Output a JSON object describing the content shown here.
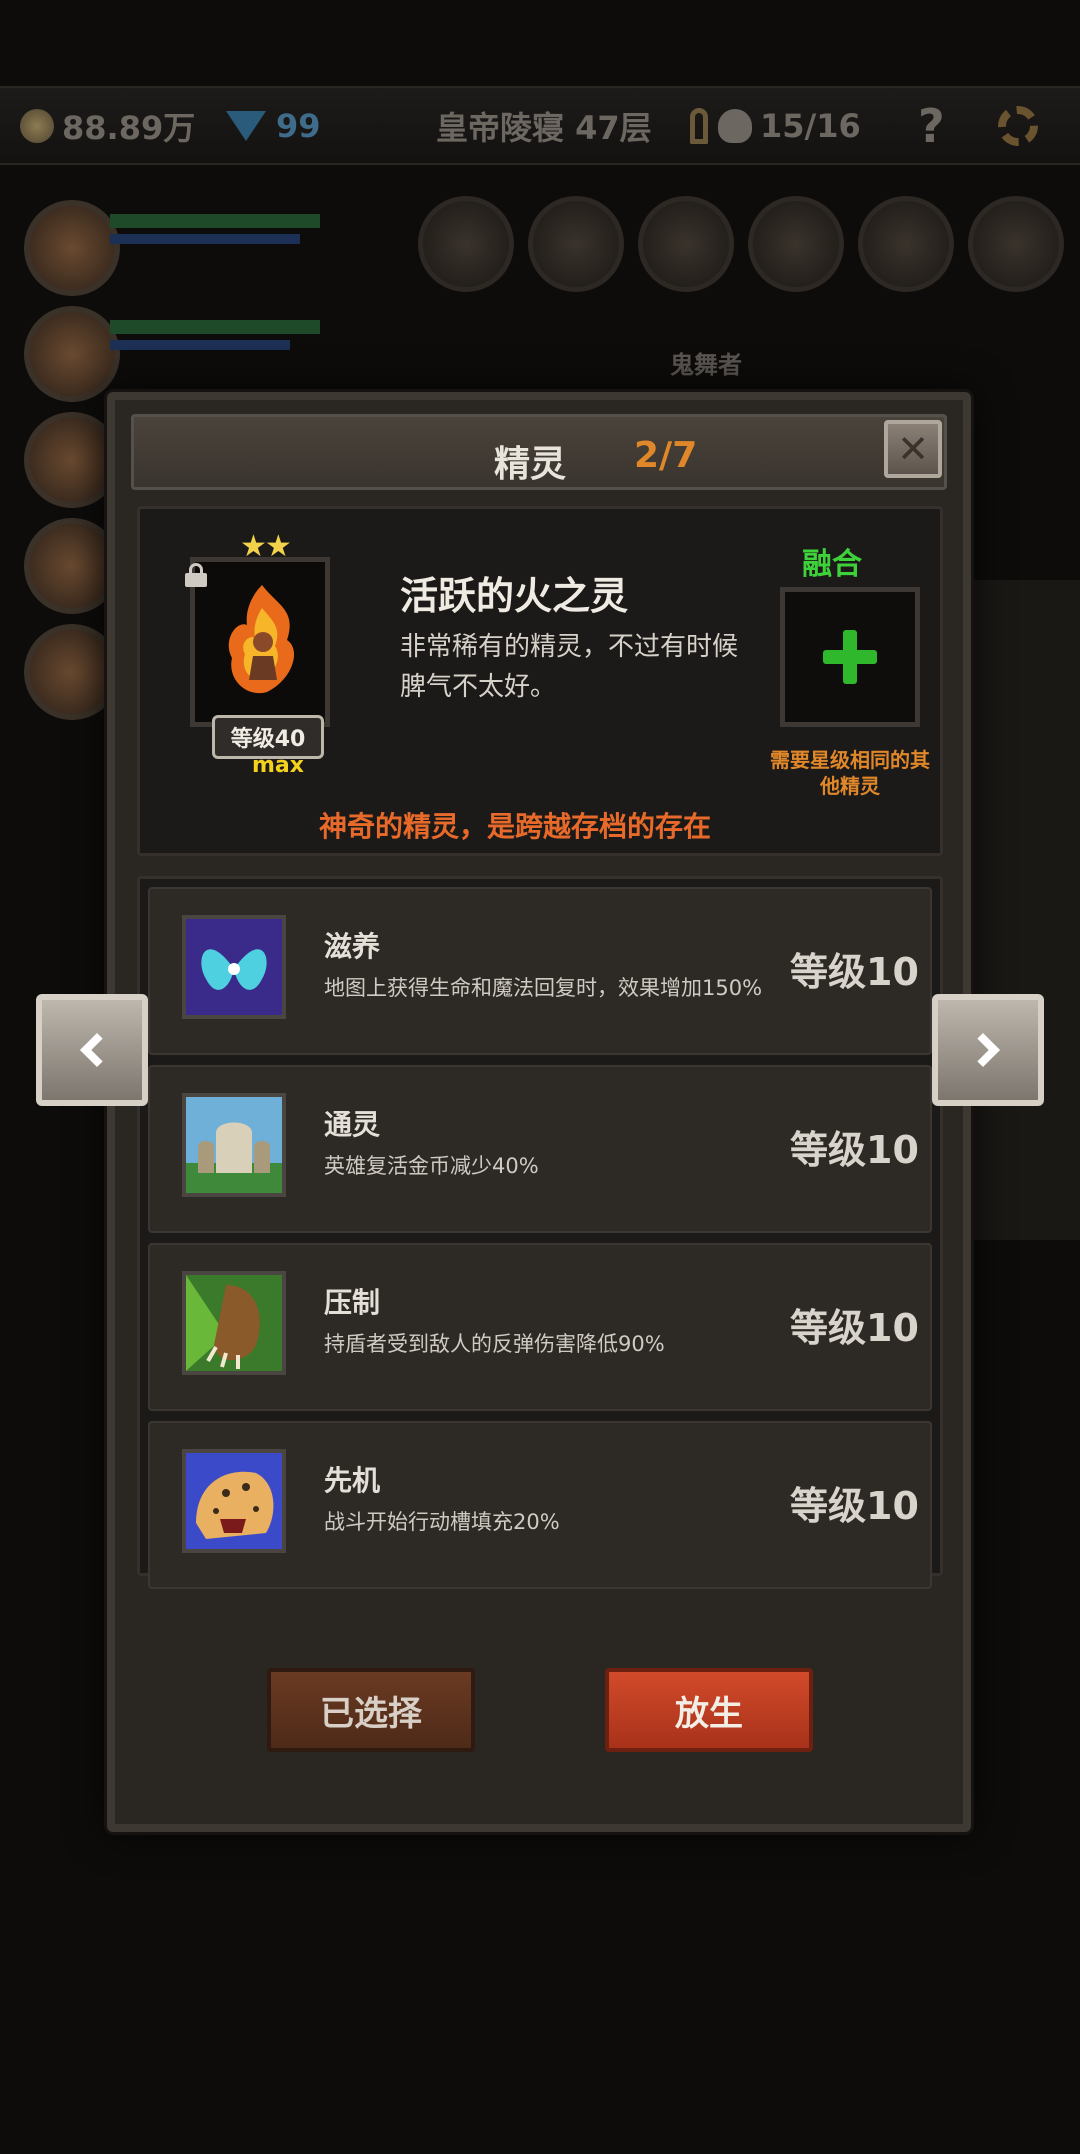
{
  "topbar": {
    "gold": "88.89万",
    "gems": "99",
    "location": "皇帝陵寝 47层",
    "deaths": "15/16",
    "help_label": "?"
  },
  "background": {
    "hero_label": "鬼舞者"
  },
  "modal": {
    "title": "精灵",
    "count": "2/7",
    "close_label": "✕"
  },
  "spirit": {
    "stars": "★★",
    "level": "等级40",
    "max": "max",
    "name": "活跃的火之灵",
    "description": "非常稀有的精灵，不过有时候脾气不太好。",
    "fuse_label": "融合",
    "fuse_hint": "需要星级相同的其他精灵",
    "tagline": "神奇的精灵，是跨越存档的存在"
  },
  "skills": [
    {
      "name": "滋养",
      "desc": "地图上获得生命和魔法回复时，效果增加150%",
      "level": "等级10",
      "icon": "fairy-wings-icon"
    },
    {
      "name": "通灵",
      "desc": "英雄复活金币减少40%",
      "level": "等级10",
      "icon": "tombstone-icon"
    },
    {
      "name": "压制",
      "desc": "持盾者受到敌人的反弹伤害降低90%",
      "level": "等级10",
      "icon": "beast-claw-icon"
    },
    {
      "name": "先机",
      "desc": "战斗开始行动槽填充20%",
      "level": "等级10",
      "icon": "leopard-icon"
    }
  ],
  "buttons": {
    "selected": "已选择",
    "release": "放生"
  }
}
